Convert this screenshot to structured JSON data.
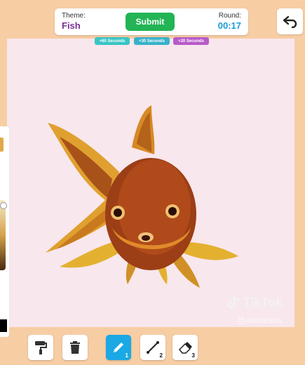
{
  "header": {
    "theme_label": "Theme:",
    "theme_value": "Fish",
    "submit_label": "Submit",
    "round_label": "Round:",
    "round_timer": "00:17"
  },
  "bonuses": [
    {
      "label": "+60 Seconds",
      "color": "#38c5c4"
    },
    {
      "label": "+30 Seconds",
      "color": "#38b2c9"
    },
    {
      "label": "+20 Seconds",
      "color": "#b65ac8"
    }
  ],
  "toolbar": {
    "tools": [
      {
        "name": "paint-roller-icon"
      },
      {
        "name": "trash-icon"
      },
      {
        "name": "pencil-icon",
        "number": "1",
        "active": true
      },
      {
        "name": "line-tool-icon",
        "number": "2"
      },
      {
        "name": "eraser-icon",
        "number": "3"
      }
    ]
  },
  "watermark": {
    "brand": "TikTok",
    "handle": "@alexrearts"
  },
  "colors": {
    "background": "#f7cda4",
    "canvas": "#f8e7ec",
    "submit": "#22b455",
    "theme_text": "#7b2f95",
    "timer_text": "#1a9bd6",
    "active_tool": "#1aa9e5"
  }
}
